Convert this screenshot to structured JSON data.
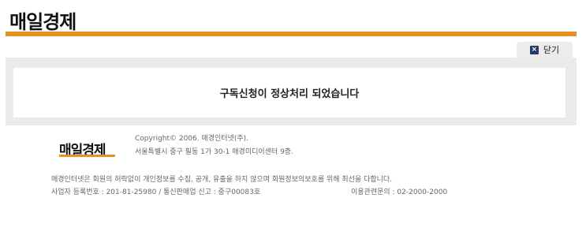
{
  "header": {
    "logo_text": "매일경제"
  },
  "close_tab": {
    "icon": "close-icon",
    "icon_glyph": "×",
    "label": "닫기"
  },
  "main": {
    "message": "구독신청이 정상처리 되었습니다"
  },
  "footer": {
    "logo_text": "매일경제",
    "copyright": "Copyright© 2006. 매경인터넷(주).",
    "address": "서울특별시 중구 필동 1가 30-1 매경미디어센터 9층.",
    "notice": "매경인터넷은 회원의 허락없이 개인정보를 수집, 공개, 유출을 하지 않으며 회원정보의보호를 위해 최선을 다합니다.",
    "registration": "사업자 등록번호 : 201-81-25980 / 통신판매업 신고 : 중구00083호",
    "inquiry": "이용관련문의 : 02-2000-2000"
  },
  "colors": {
    "accent_orange": "#e8911e",
    "close_icon_bg": "#223a6a",
    "panel_gray": "#ebebeb"
  }
}
